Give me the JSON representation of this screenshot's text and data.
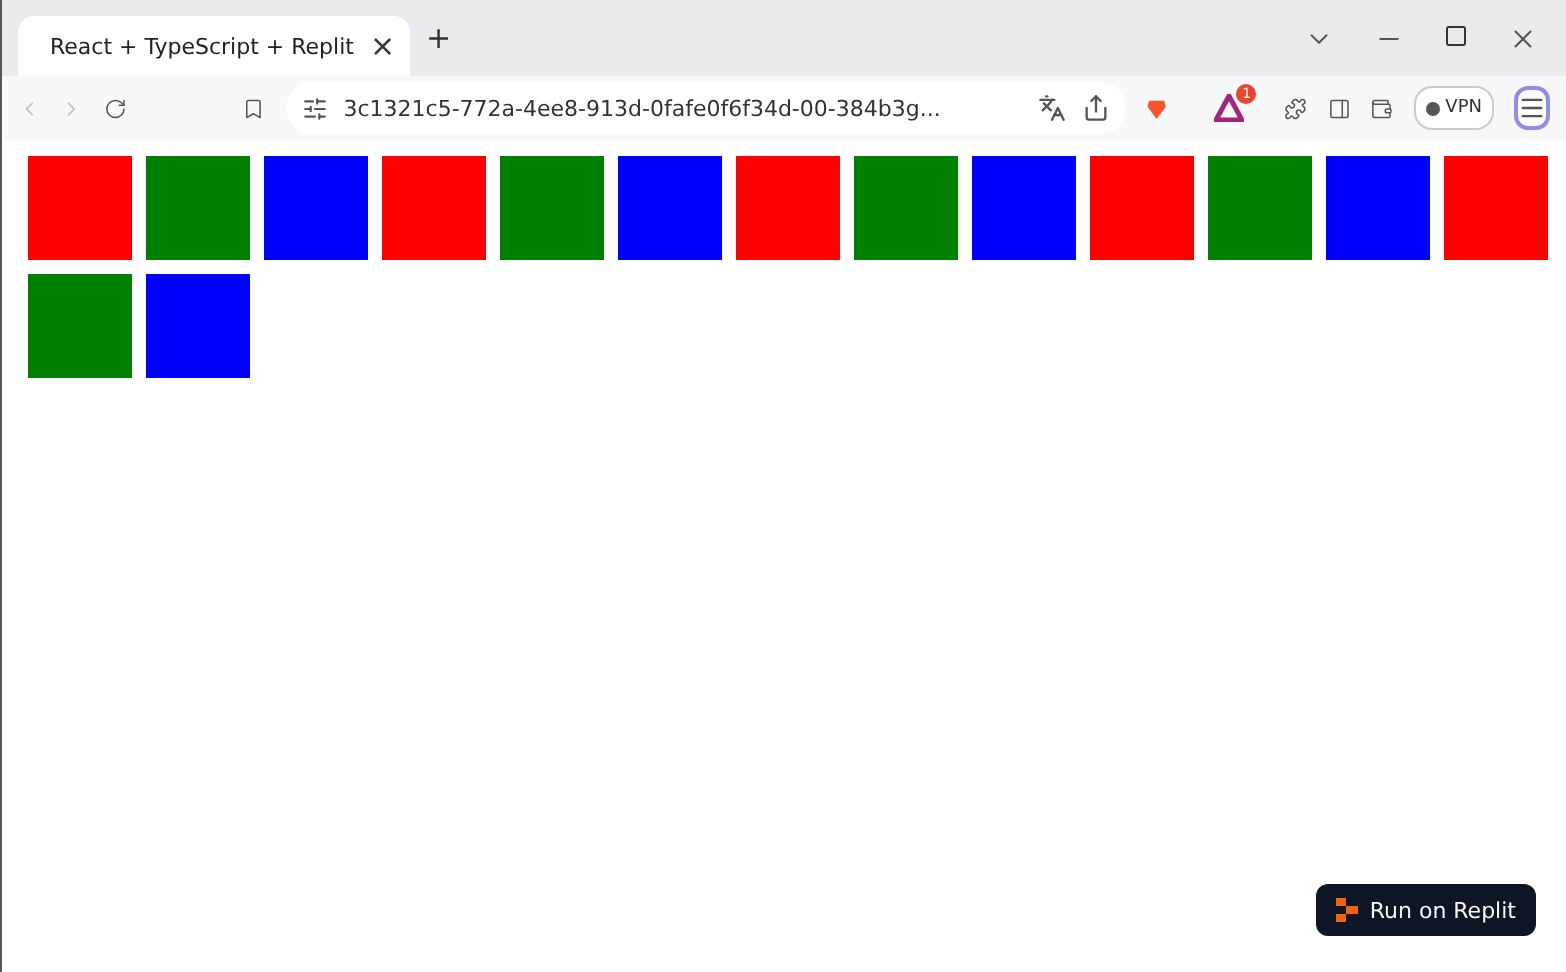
{
  "tab": {
    "title": "React + TypeScript + Replit",
    "close": "×",
    "new_tab": "+"
  },
  "address_bar": {
    "url": "3c1321c5-772a-4ee8-913d-0fafe0f6f34d-00-384b3g..."
  },
  "toolbar": {
    "alert_badge": "1",
    "vpn": "VPN"
  },
  "squares": [
    {
      "color": "#ff0000"
    },
    {
      "color": "#008000"
    },
    {
      "color": "#0000ff"
    },
    {
      "color": "#ff0000"
    },
    {
      "color": "#008000"
    },
    {
      "color": "#0000ff"
    },
    {
      "color": "#ff0000"
    },
    {
      "color": "#008000"
    },
    {
      "color": "#0000ff"
    },
    {
      "color": "#ff0000"
    },
    {
      "color": "#008000"
    },
    {
      "color": "#0000ff"
    },
    {
      "color": "#ff0000"
    },
    {
      "color": "#008000"
    },
    {
      "color": "#0000ff"
    }
  ],
  "run_button": {
    "label": "Run on Replit"
  }
}
